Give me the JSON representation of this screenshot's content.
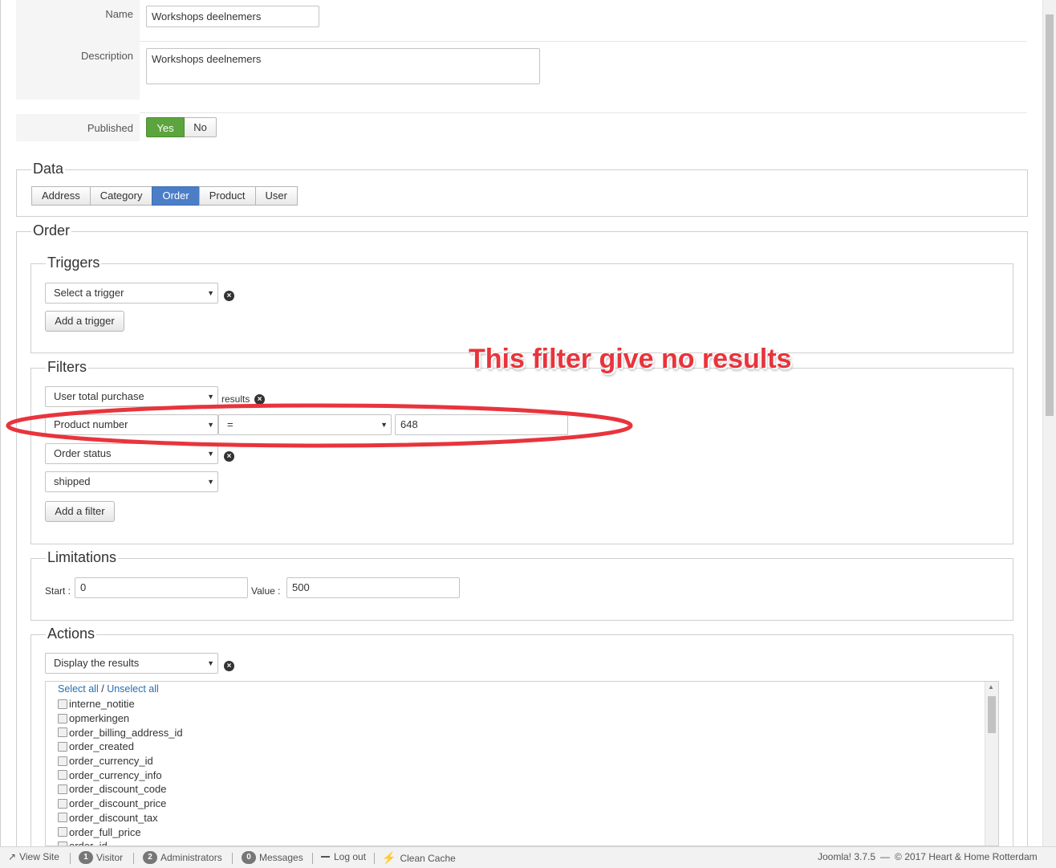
{
  "form": {
    "name_label": "Name",
    "name_value": "Workshops deelnemers",
    "description_label": "Description",
    "description_value": "Workshops deelnemers",
    "published_label": "Published",
    "published_yes": "Yes",
    "published_no": "No",
    "published_value": "Yes"
  },
  "data_section": {
    "legend": "Data",
    "tabs": [
      "Address",
      "Category",
      "Order",
      "Product",
      "User"
    ],
    "active_tab": "Order"
  },
  "order_section": {
    "legend": "Order",
    "triggers": {
      "legend": "Triggers",
      "select_value": "Select a trigger",
      "add_label": "Add a trigger"
    },
    "filters": {
      "legend": "Filters",
      "filter1_select": "User total purchase",
      "filter1_results": "results",
      "filter2_field": "Product number",
      "filter2_operator": "=",
      "filter2_value": "648",
      "filter3_select": "Order status",
      "filter3_value": "shipped",
      "add_label": "Add a filter"
    },
    "limitations": {
      "legend": "Limitations",
      "start_label": "Start :",
      "start_value": "0",
      "value_label": "Value :",
      "value_value": "500"
    },
    "actions": {
      "legend": "Actions",
      "select_value": "Display the results",
      "select_all": "Select all",
      "slash": "/",
      "unselect_all": "Unselect all",
      "columns": [
        "interne_notitie",
        "opmerkingen",
        "order_billing_address_id",
        "order_created",
        "order_currency_id",
        "order_currency_info",
        "order_discount_code",
        "order_discount_price",
        "order_discount_tax",
        "order_full_price",
        "order_id"
      ]
    }
  },
  "annotation": {
    "text": "This filter give no results",
    "color": "#e8343c"
  },
  "statusbar": {
    "view_site": "View Site",
    "visitor_count": "1",
    "visitor_label": "Visitor",
    "admin_count": "2",
    "admin_label": "Administrators",
    "messages_count": "0",
    "messages_label": "Messages",
    "logout": "Log out",
    "clean_cache": "Clean Cache",
    "version": "Joomla! 3.7.5",
    "dash": "—",
    "copyright": "© 2017 Heart & Home Rotterdam"
  },
  "colors": {
    "accent_blue": "#4b7ec7",
    "yes_green": "#5ca43d",
    "link_blue": "#2a6db0"
  }
}
